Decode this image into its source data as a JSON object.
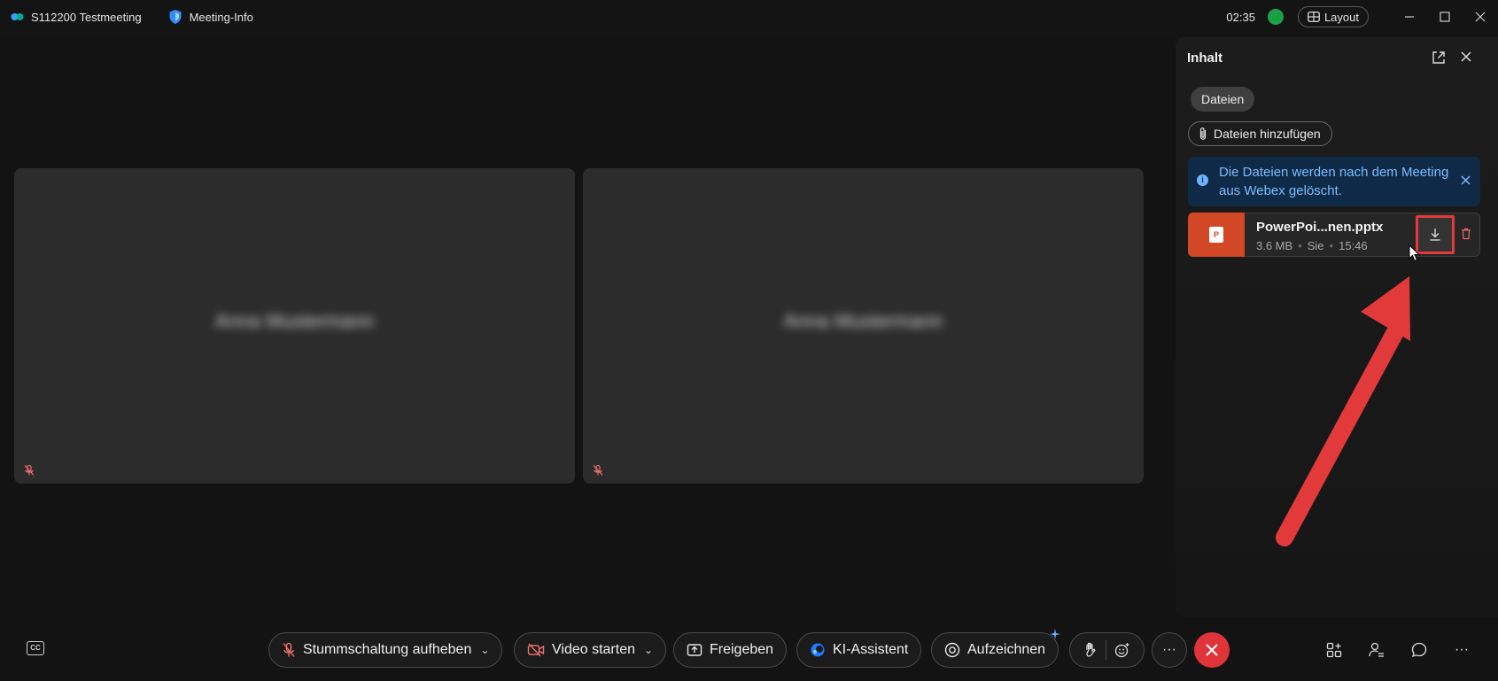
{
  "titlebar": {
    "meeting_name": "S112200 Testmeeting",
    "meeting_info": "Meeting-Info",
    "clock": "02:35",
    "layout_label": "Layout"
  },
  "tiles": [
    {
      "participant": "Anna Mustermann"
    },
    {
      "participant": "Anna Mustermann"
    }
  ],
  "panel": {
    "title": "Inhalt",
    "chip_label": "Dateien",
    "add_files_label": "Dateien hinzufügen",
    "info_message": "Die Dateien werden nach dem Meeting aus Webex gelöscht.",
    "file": {
      "name": "PowerPoi...nen.pptx",
      "size": "3.6 MB",
      "owner": "Sie",
      "time": "15:46"
    }
  },
  "toolbar": {
    "unmute_label": "Stummschaltung aufheben",
    "video_label": "Video starten",
    "share_label": "Freigeben",
    "ai_label": "KI-Assistent",
    "record_label": "Aufzeichnen",
    "more_label": "···",
    "cc_label": "CC"
  },
  "colors": {
    "end_call": "#e0343b",
    "accent_blue": "#79bdff",
    "annotation_red": "#e23a3a",
    "ppt_orange": "#d24726"
  }
}
